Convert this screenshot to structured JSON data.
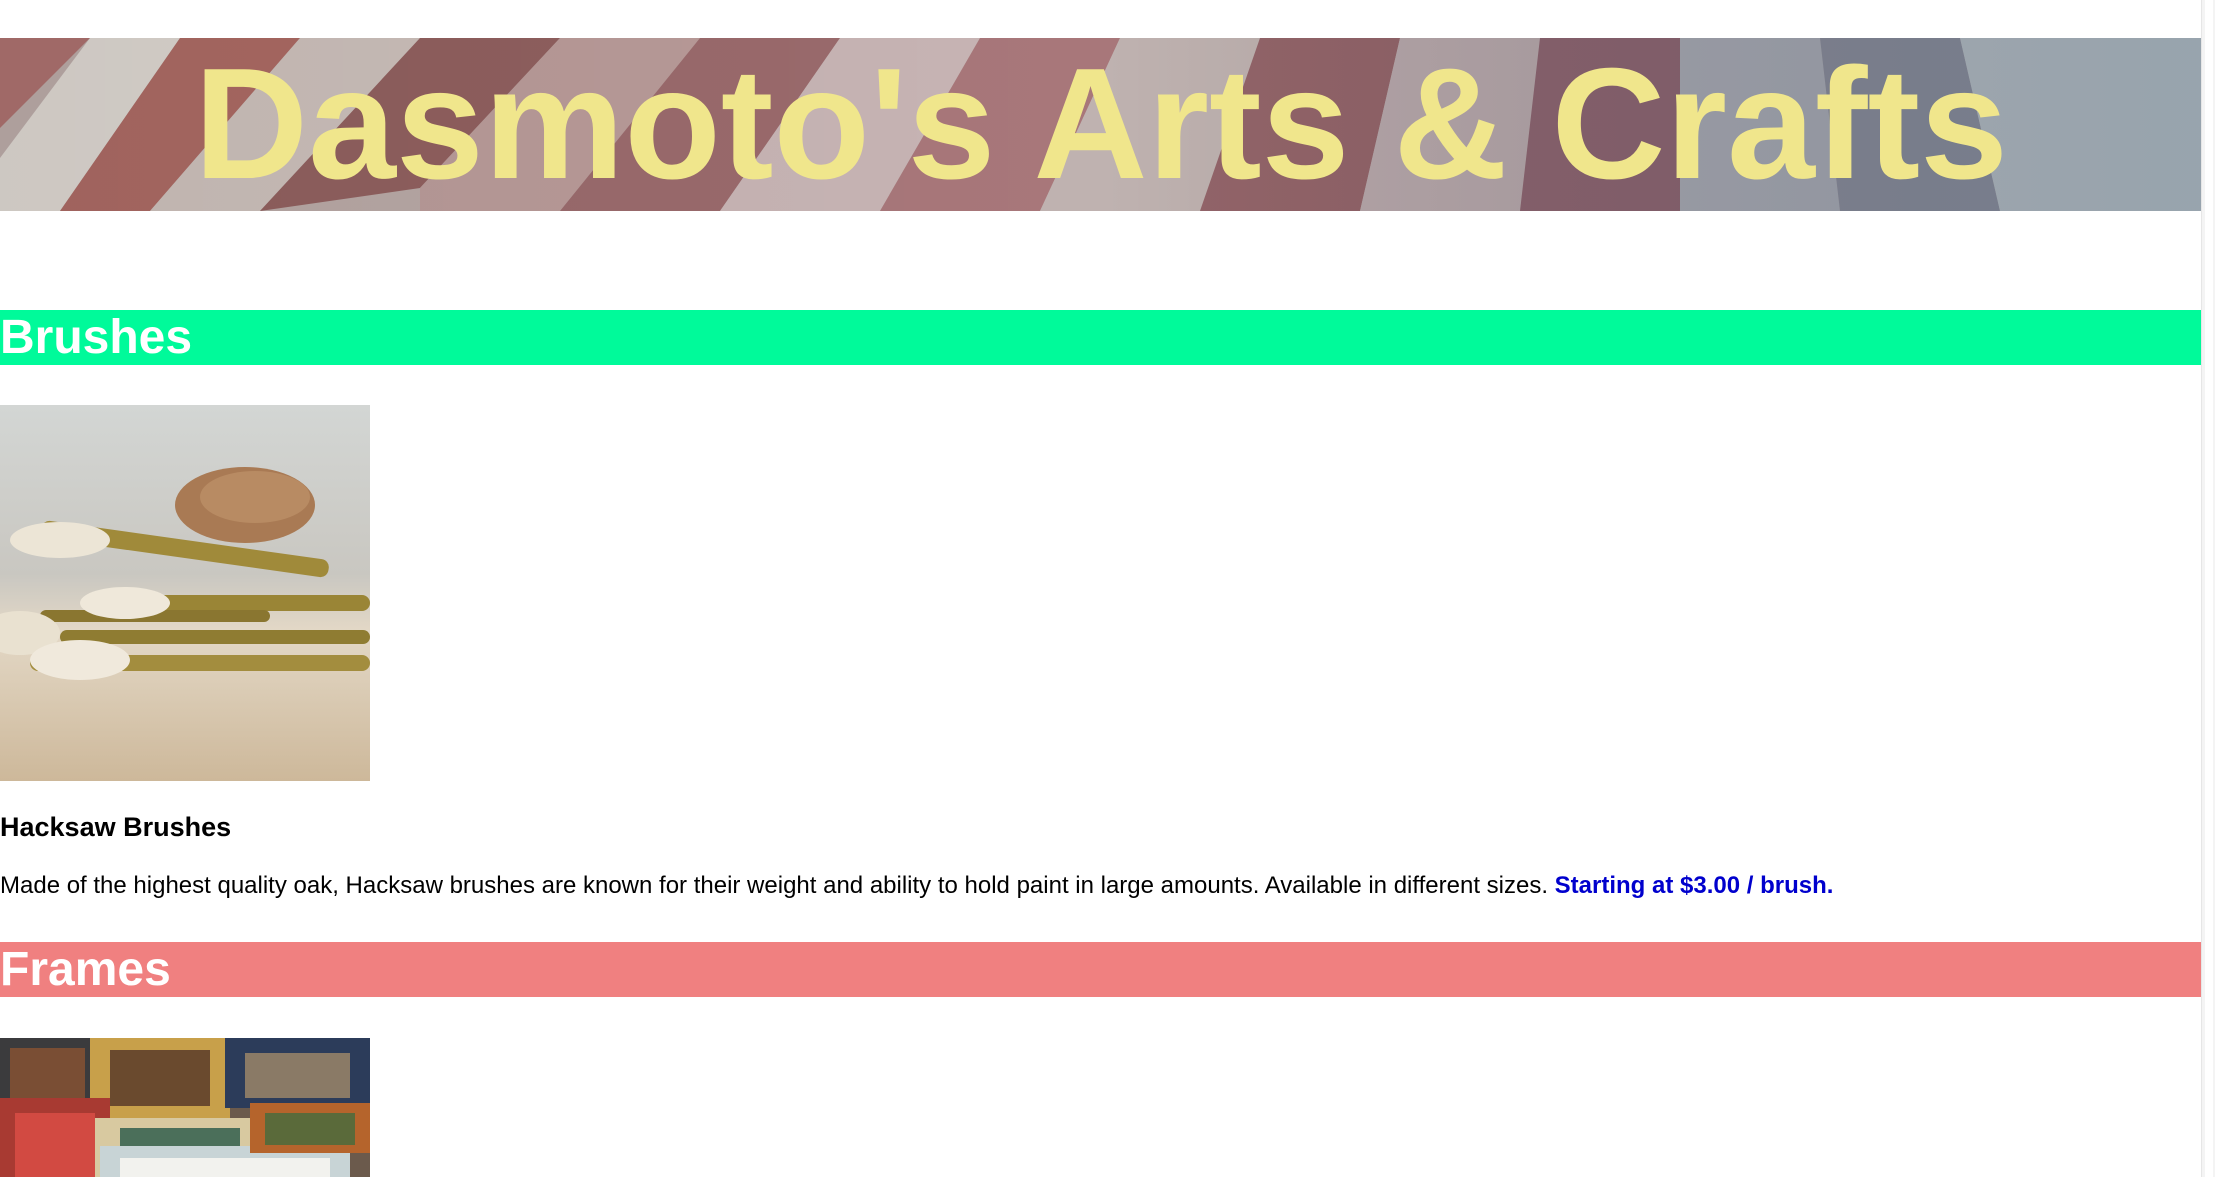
{
  "header": {
    "title": "Dasmoto's Arts & Crafts"
  },
  "sections": [
    {
      "heading": "Brushes",
      "color": "#00fa9a",
      "item": {
        "title": "Hacksaw Brushes",
        "description": "Made of the highest quality oak, Hacksaw brushes are known for their weight and ability to hold paint in large amounts. Available in different sizes.",
        "price": "Starting at $3.00 / brush."
      }
    },
    {
      "heading": "Frames",
      "color": "#f08080"
    }
  ],
  "colors": {
    "title_text": "#f0e68c",
    "price_text": "#0000cd",
    "heading_text": "#ffffff"
  }
}
